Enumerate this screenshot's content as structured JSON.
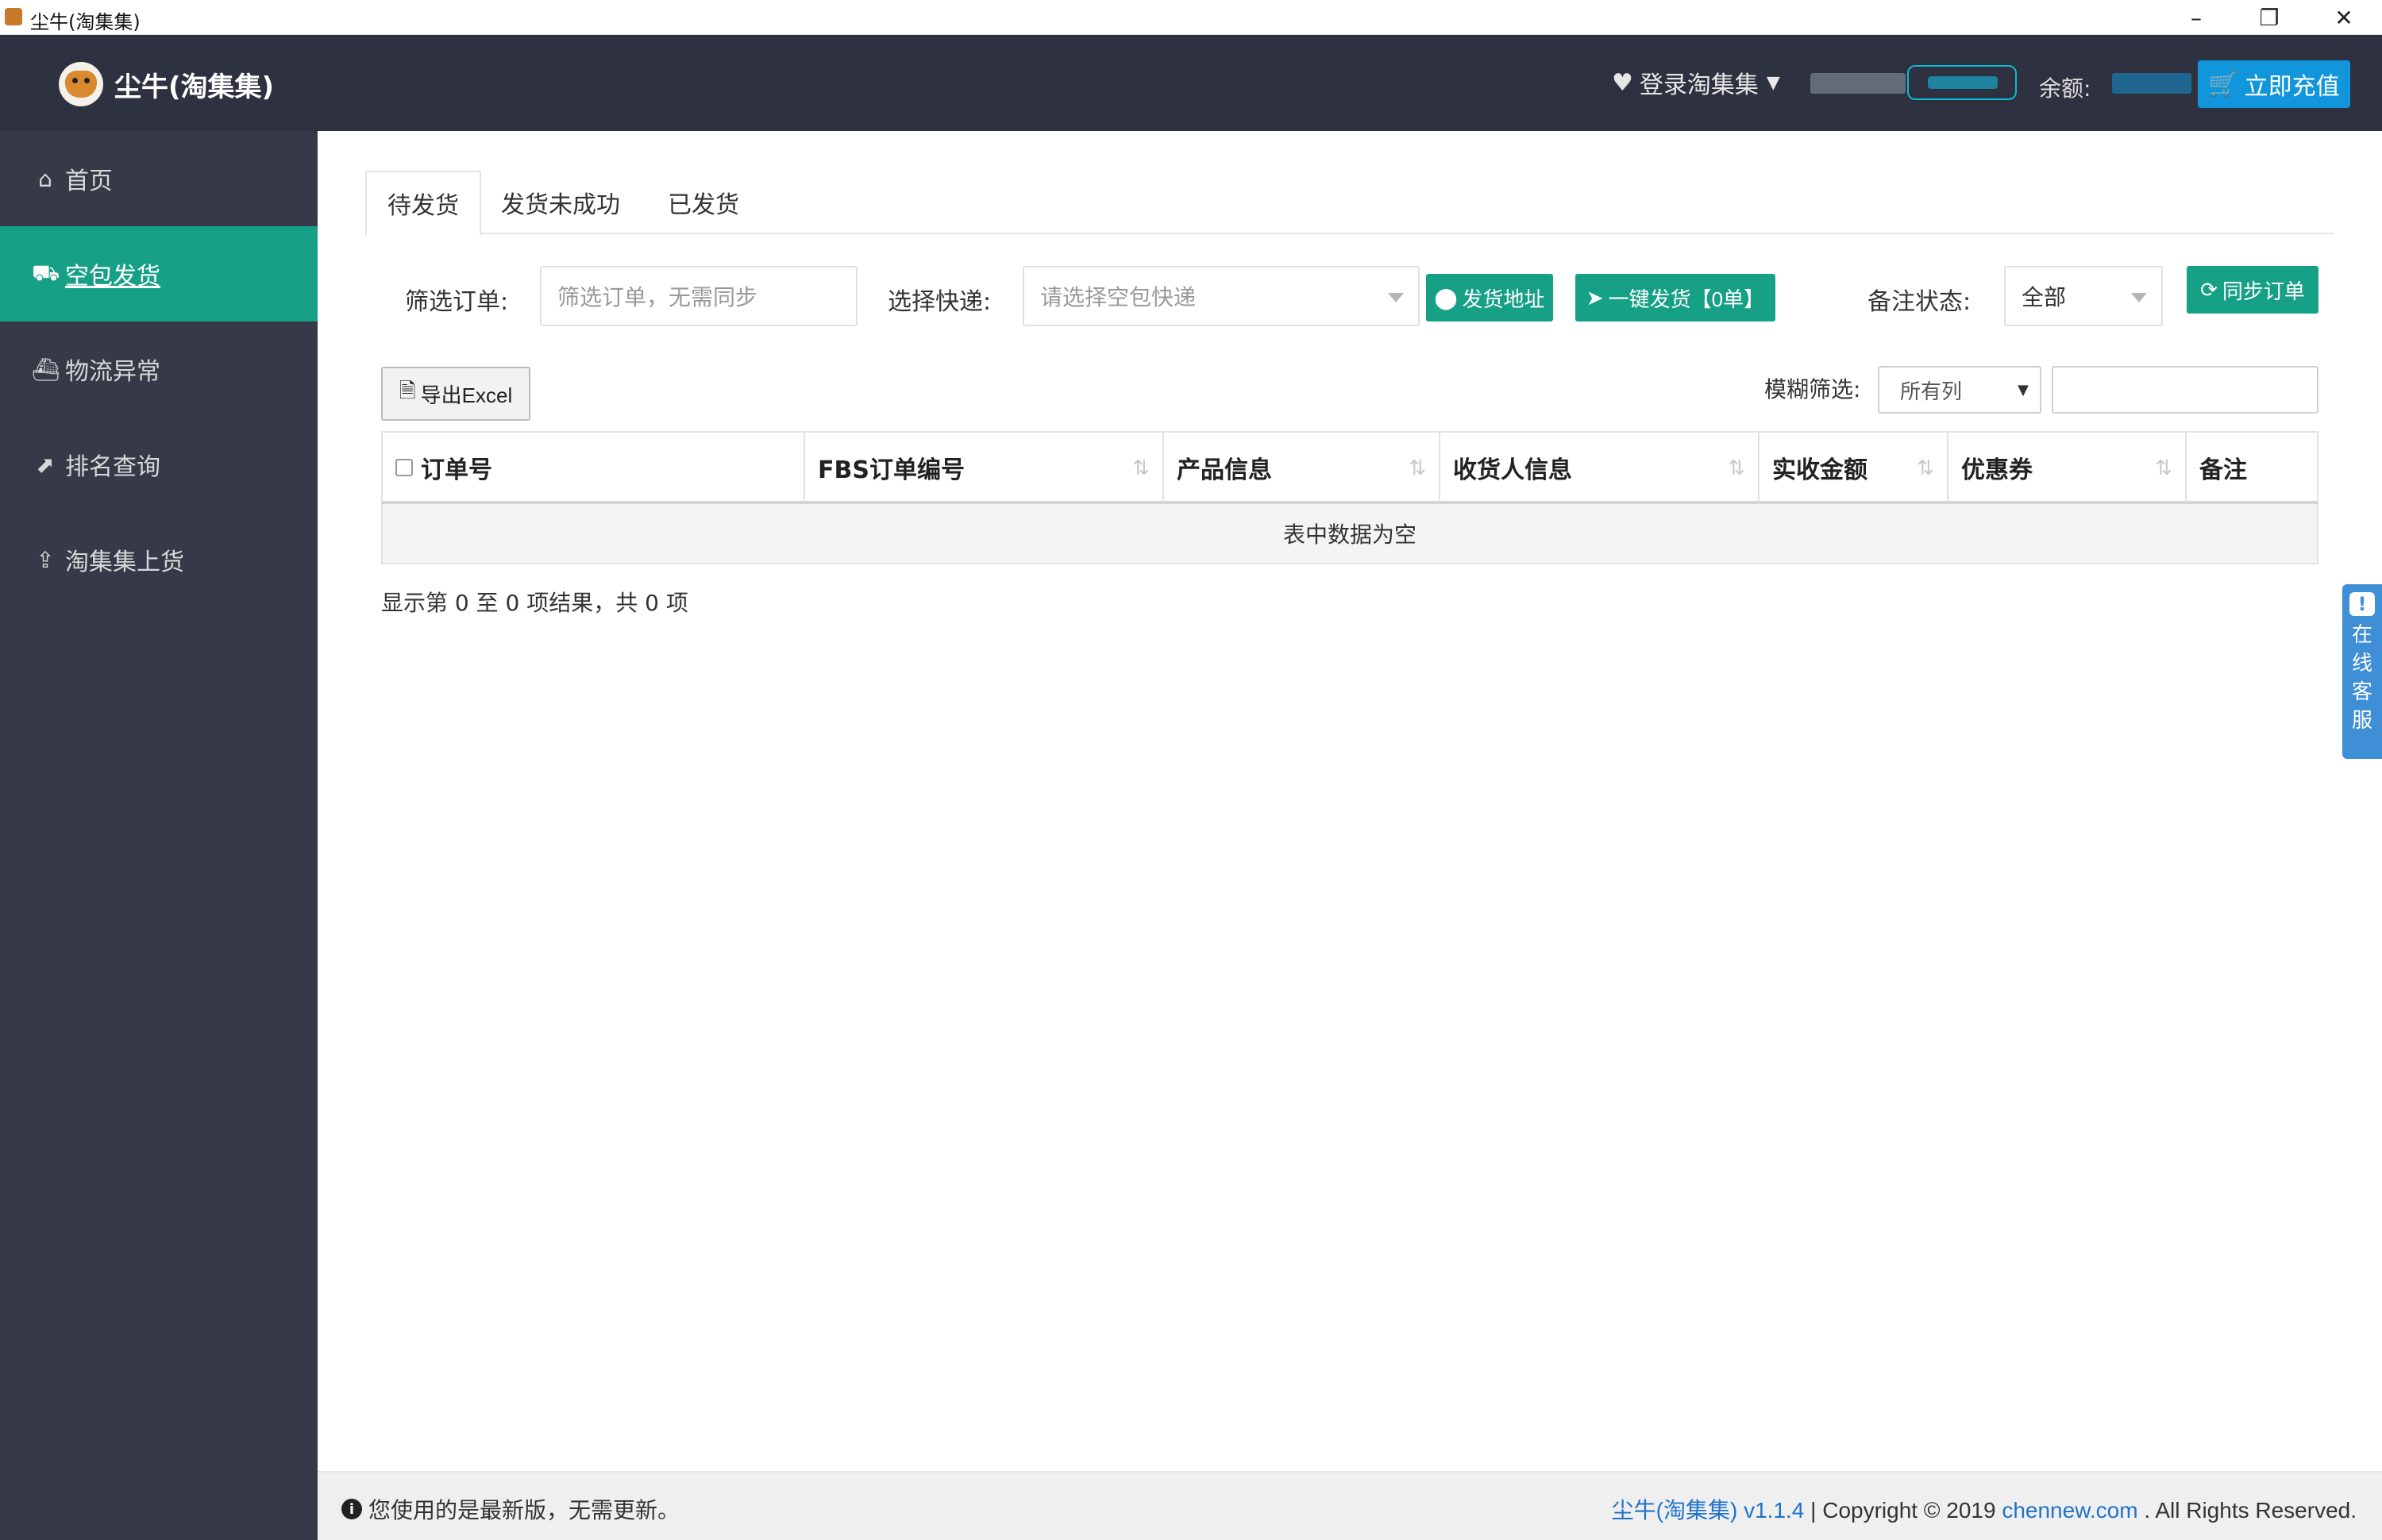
{
  "window": {
    "title": "尘牛(淘集集)",
    "minimize_icon": "–",
    "maximize_icon": "❐",
    "close_icon": "✕"
  },
  "header": {
    "brand_name": "尘牛(淘集集)",
    "login_menu_label": "登录淘集集",
    "balance_label": "余额:",
    "recharge_label": "立即充值",
    "colors": {
      "header_bg": "#2d3140",
      "recharge_bg": "#1296db"
    }
  },
  "sidebar": {
    "items": [
      {
        "label": "首页",
        "icon": "home-icon",
        "active": false
      },
      {
        "label": "空包发货",
        "icon": "truck-icon",
        "active": true
      },
      {
        "label": "物流异常",
        "icon": "ship-icon",
        "active": false
      },
      {
        "label": "排名查询",
        "icon": "chart-icon",
        "active": false
      },
      {
        "label": "淘集集上货",
        "icon": "upload-icon",
        "active": false
      }
    ],
    "colors": {
      "bg": "#363a48",
      "active_bg": "#16a085"
    }
  },
  "tabs": [
    {
      "label": "待发货",
      "active": true
    },
    {
      "label": "发货未成功",
      "active": false
    },
    {
      "label": "已发货",
      "active": false
    }
  ],
  "filters": {
    "order_label": "筛选订单:",
    "order_placeholder": "筛选订单，无需同步",
    "express_label": "选择快递:",
    "express_placeholder": "请选择空包快递",
    "address_button": "发货地址",
    "one_click_button": "一键发货【0单】",
    "remark_label": "备注状态:",
    "remark_value": "全部",
    "sync_button": "同步订单"
  },
  "toolbar": {
    "export_button": "导出Excel",
    "fuzzy_label": "模糊筛选:",
    "fuzzy_select_value": "所有列",
    "fuzzy_input_value": ""
  },
  "table": {
    "columns": [
      "订单号",
      "FBS订单编号",
      "产品信息",
      "收货人信息",
      "实收金额",
      "优惠券",
      "备注"
    ],
    "empty_text": "表中数据为空",
    "result_info": "显示第 0 至 0 项结果，共 0 项"
  },
  "service_tab": {
    "label": [
      "在",
      "线",
      "客",
      "服"
    ]
  },
  "footer": {
    "update_message": "您使用的是最新版，无需更新。",
    "product_link": "尘牛(淘集集) v1.1.4",
    "copyright_text": " | Copyright © 2019 ",
    "site_link": "chennew.com",
    "rights_text": " . All Rights Reserved."
  }
}
